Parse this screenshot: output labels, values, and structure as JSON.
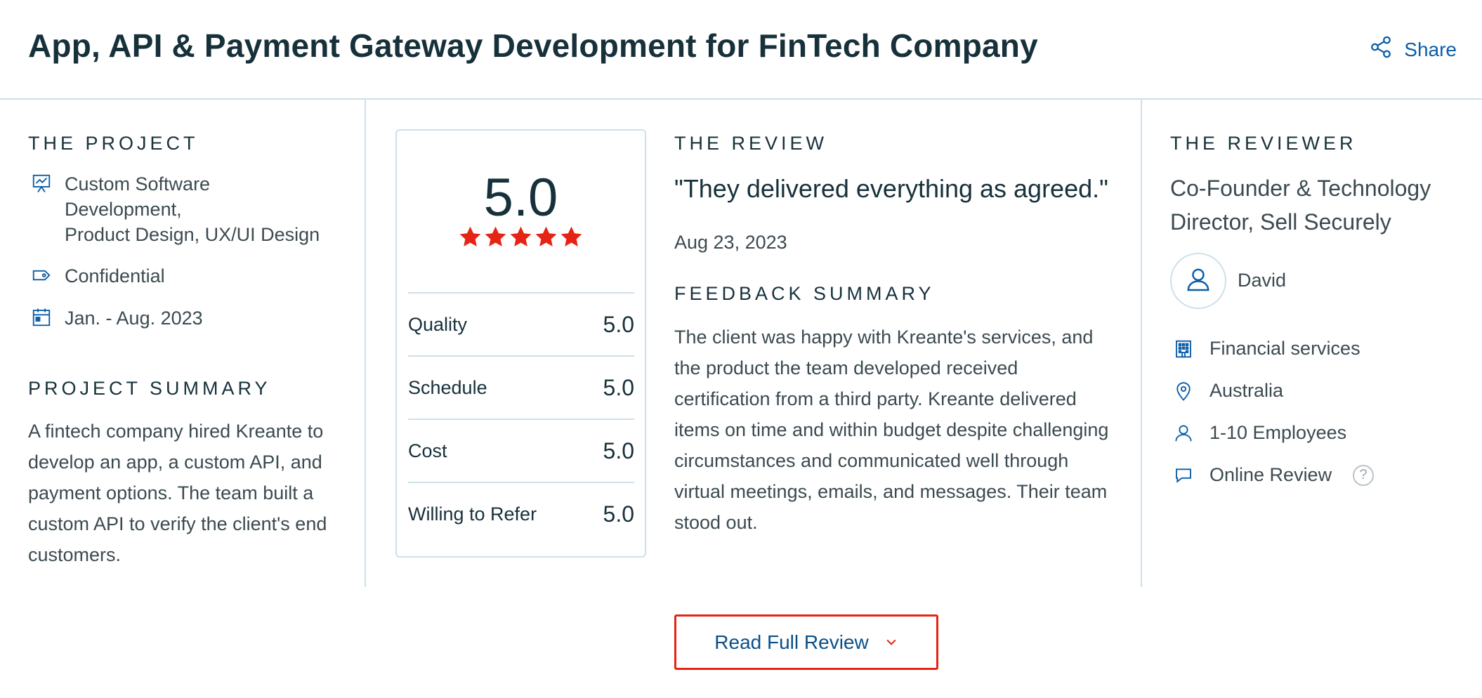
{
  "header": {
    "title": "App, API & Payment Gateway Development for FinTech Company",
    "share_label": "Share"
  },
  "project": {
    "section_label": "THE PROJECT",
    "service_line1": "Custom Software",
    "service_line2": "Development,",
    "service_line3": "Product Design, UX/UI Design",
    "budget": "Confidential",
    "dates": "Jan. - Aug. 2023",
    "summary_label": "PROJECT SUMMARY",
    "summary": "A fintech company hired Kreante to develop an app, a custom API, and payment options. The team built a custom API to verify the client's end customers."
  },
  "rating": {
    "overall": "5.0",
    "stars": 5,
    "rows": [
      {
        "label": "Quality",
        "value": "5.0"
      },
      {
        "label": "Schedule",
        "value": "5.0"
      },
      {
        "label": "Cost",
        "value": "5.0"
      },
      {
        "label": "Willing to Refer",
        "value": "5.0"
      }
    ]
  },
  "review": {
    "section_label": "THE REVIEW",
    "quote": "\"They delivered everything as agreed.\"",
    "date": "Aug 23, 2023",
    "feedback_label": "FEEDBACK SUMMARY",
    "feedback": "The client was happy with Kreante's services, and the product the team developed received certification from a third party. Kreante delivered items on time and within budget despite challenging circumstances and communicated well through virtual meetings, emails, and messages. Their team stood out."
  },
  "reviewer": {
    "section_label": "THE REVIEWER",
    "title": "Co-Founder & Technology Director, Sell Securely",
    "name": "David",
    "industry": "Financial services",
    "location": "Australia",
    "company_size": "1-10 Employees",
    "review_type": "Online Review",
    "help_symbol": "?"
  },
  "actions": {
    "read_full_label": "Read Full Review"
  },
  "colors": {
    "accent_blue": "#0b5ea8",
    "star_red": "#e62415",
    "border": "#cde0e8",
    "text_dark": "#17313b"
  },
  "icons": {
    "share": "share-icon",
    "service": "presentation-icon",
    "budget": "tag-icon",
    "dates": "calendar-icon",
    "star": "star-icon",
    "avatar": "user-icon",
    "industry": "building-icon",
    "location": "map-pin-icon",
    "size": "user-icon",
    "review_type": "chat-bubble-icon",
    "help": "help-icon",
    "expand": "chevron-down-icon"
  }
}
